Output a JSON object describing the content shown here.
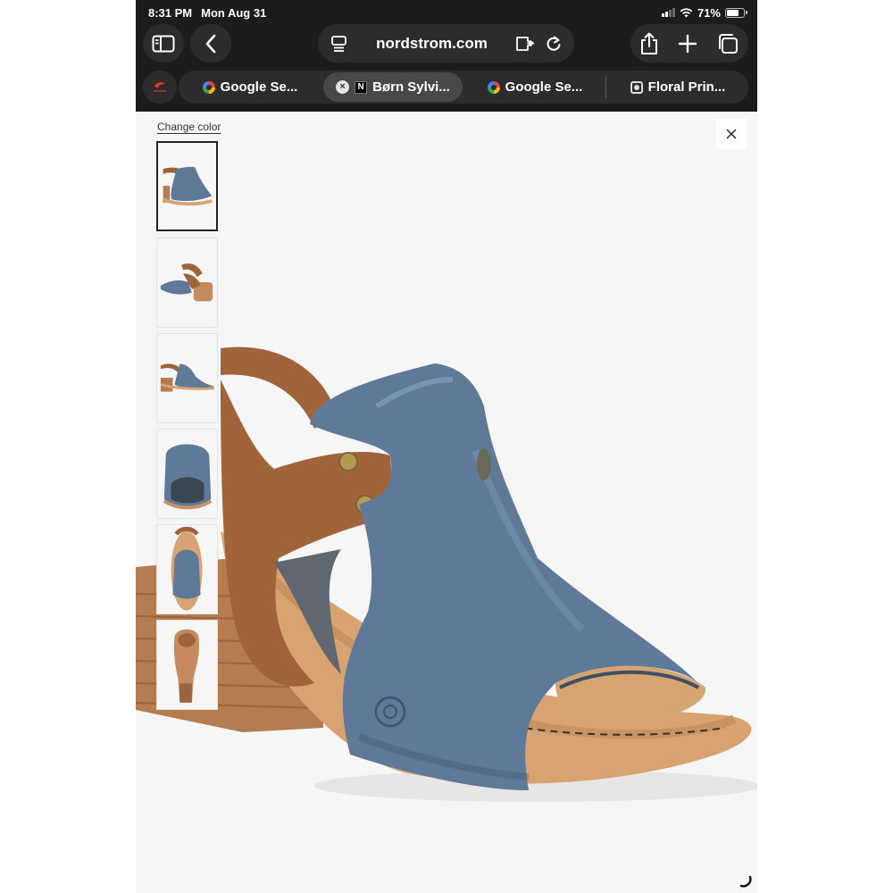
{
  "status_bar": {
    "time": "8:31 PM",
    "date": "Mon Aug 31",
    "battery": "71%",
    "battery_level": 0.71
  },
  "address_bar": {
    "url": "nordstrom.com"
  },
  "tabs": [
    {
      "label": "Google Se...",
      "icon": "google-icon",
      "active": false
    },
    {
      "label": "Børn Sylvi...",
      "icon": "nordstrom-icon",
      "active": true
    },
    {
      "label": "Google Se...",
      "icon": "google-icon",
      "active": false
    },
    {
      "label": "Floral Prin...",
      "icon": "pinned-site-icon",
      "active": false
    }
  ],
  "viewer": {
    "change_color": "Change color",
    "thumbnails": [
      {
        "view": "side-view",
        "selected": true
      },
      {
        "view": "back-angle-view",
        "selected": false
      },
      {
        "view": "inner-side-view",
        "selected": false
      },
      {
        "view": "front-view",
        "selected": false
      },
      {
        "view": "top-view",
        "selected": false
      },
      {
        "view": "sole-view",
        "selected": false
      }
    ],
    "main_image": "blue-leather-sandal-with-brown-heel-strap"
  },
  "colors": {
    "chrome": "#1c1c1e",
    "pill": "#2c2c2e",
    "shoe_blue": "#5f7a99",
    "shoe_tan": "#a0633a",
    "heel_wood": "#b57c4f"
  }
}
